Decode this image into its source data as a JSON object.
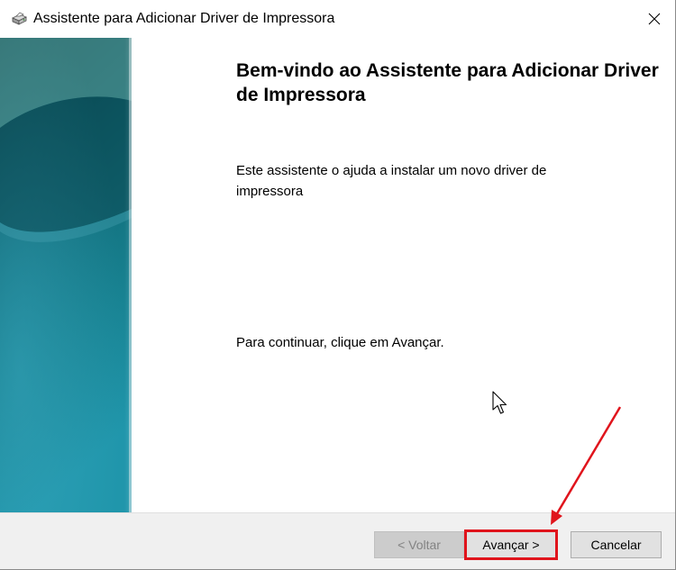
{
  "window": {
    "title": "Assistente para Adicionar Driver de Impressora",
    "icon": "printer-icon",
    "close_icon": "close-icon"
  },
  "content": {
    "heading": "Bem-vindo ao Assistente para Adicionar Driver de Impressora",
    "description": "Este assistente o ajuda a instalar um novo driver de impressora",
    "instruction": "Para continuar, clique em Avançar."
  },
  "footer": {
    "back_label": "< Voltar",
    "next_label": "Avançar >",
    "cancel_label": "Cancelar"
  },
  "colors": {
    "side_panel_dark": "#0d4f59",
    "side_panel_light": "#1f8fa6",
    "highlight": "#e0141c",
    "footer_bg": "#f0f0f0"
  }
}
